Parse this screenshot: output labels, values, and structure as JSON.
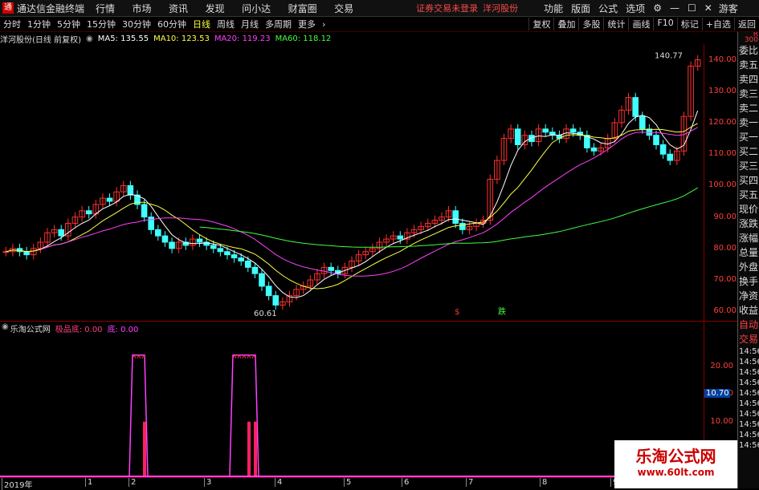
{
  "titlebar": {
    "app_name": "通达信金融终端",
    "menus": [
      "行情",
      "市场",
      "资讯",
      "发现",
      "问小达",
      "财富圈",
      "交易"
    ],
    "status": "证券交易未登录",
    "stock": "洋河股份",
    "buttons": [
      "功能",
      "版面",
      "公式",
      "选项"
    ],
    "guest": "游客"
  },
  "toolbar": {
    "periods": [
      "分时",
      "1分钟",
      "5分钟",
      "15分钟",
      "30分钟",
      "60分钟",
      "日线",
      "周线",
      "月线",
      "多周期",
      "更多"
    ],
    "active_period": "日线",
    "right_buttons": [
      "复权",
      "叠加",
      "多股",
      "统计",
      "画线",
      "F10",
      "标记",
      "+自选",
      "返回"
    ]
  },
  "main_chart": {
    "title": "洋河股份(日线 前复权)",
    "ma": [
      {
        "label": "MA5: 135.55",
        "color": "#ffffff"
      },
      {
        "label": "MA10: 123.53",
        "color": "#ffff40"
      },
      {
        "label": "MA20: 119.23",
        "color": "#ff40ff"
      },
      {
        "label": "MA60: 118.12",
        "color": "#40ff40"
      }
    ],
    "high_label": "140.77",
    "low_label": "60.61",
    "marker_red": "$",
    "marker_green": "跌",
    "yticks": [
      "140.00",
      "130.00",
      "120.00",
      "110.00",
      "100.00",
      "90.00",
      "80.00",
      "70.00",
      "60.00"
    ]
  },
  "indicator": {
    "title": "乐淘公式网",
    "line1": "极品底: 0.00",
    "line2": "底: 0.00",
    "yticks": [
      "20.00",
      "15.00",
      "10.00"
    ],
    "current_value": "10.70"
  },
  "xaxis": {
    "labels": [
      "2019年",
      "1",
      "2",
      "3",
      "4",
      "5",
      "6",
      "7",
      "8",
      "9"
    ]
  },
  "side_panel": {
    "items": [
      "委比",
      "卖五",
      "卖四",
      "卖三",
      "卖二",
      "卖一",
      "买一",
      "买二",
      "买三",
      "买四",
      "买五",
      "现价",
      "涨跌",
      "涨幅",
      "总量",
      "外盘",
      "换手",
      "净资",
      "收益"
    ],
    "bottom": [
      "自动",
      "交易",
      "14:56",
      "14:56",
      "14:56",
      "14:56",
      "14:56",
      "14:56",
      "14:56",
      "14:56",
      "14:56",
      "14:56"
    ]
  },
  "watermark": {
    "text": "乐淘公式网",
    "url": "www.60lt.com"
  },
  "chart_data": {
    "type": "candlestick",
    "ylim": [
      57,
      145
    ],
    "close": [
      79,
      80,
      79,
      78,
      80,
      82,
      85,
      86,
      84,
      88,
      90,
      92,
      91,
      94,
      96,
      95,
      98,
      100,
      97,
      94,
      90,
      86,
      84,
      82,
      80,
      82,
      81,
      83,
      82,
      81,
      80,
      79,
      78,
      77,
      76,
      74,
      72,
      68,
      65,
      62,
      63,
      65,
      67,
      68,
      70,
      72,
      74,
      73,
      72,
      74,
      76,
      78,
      79,
      80,
      82,
      83,
      84,
      83,
      85,
      86,
      87,
      88,
      89,
      90,
      92,
      88,
      86,
      87,
      88,
      89,
      102,
      108,
      115,
      118,
      113,
      116,
      114,
      118,
      117,
      116,
      115,
      118,
      117,
      116,
      112,
      111,
      112,
      115,
      120,
      124,
      128,
      122,
      118,
      116,
      113,
      110,
      108,
      111,
      122,
      138,
      140
    ],
    "ma_smooth": {
      "ma20": [
        80,
        81,
        83,
        86,
        89,
        93,
        95,
        90,
        84,
        82,
        80,
        78,
        73,
        68,
        65,
        67,
        70,
        74,
        78,
        82,
        86,
        88,
        90,
        96,
        105,
        112,
        116,
        117,
        116,
        118,
        120,
        118,
        116,
        114,
        115,
        120
      ],
      "ma60": [
        86,
        85,
        83,
        80,
        77,
        75,
        74,
        74,
        75,
        77,
        80,
        83,
        85,
        88,
        91,
        95,
        100,
        104,
        108,
        111,
        114,
        117,
        118
      ]
    },
    "indicator_signals": [
      {
        "x_idx": 0,
        "value": 22
      },
      {
        "x_idx": 1,
        "value": 22
      },
      {
        "x_idx": 2,
        "value": 22
      }
    ]
  }
}
